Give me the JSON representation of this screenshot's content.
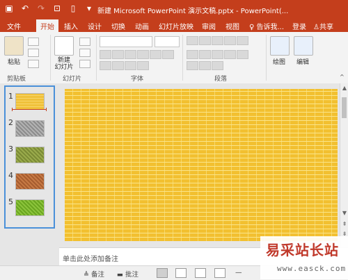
{
  "titlebar": {
    "title": "新建 Microsoft PowerPoint 演示文稿.pptx - PowerPoint(...",
    "bg_color": "#c43e1c"
  },
  "qat": {
    "save_icon": "floppy-icon",
    "undo_icon": "undo-icon",
    "redo_icon": "redo-icon",
    "present_icon": "presentation-icon",
    "new_icon": "new-document-icon"
  },
  "tabs": [
    {
      "label": "文件"
    },
    {
      "label": "开始"
    },
    {
      "label": "插入"
    },
    {
      "label": "设计"
    },
    {
      "label": "切换"
    },
    {
      "label": "动画"
    },
    {
      "label": "幻灯片放映"
    },
    {
      "label": "审阅"
    },
    {
      "label": "视图"
    },
    {
      "label": "♀ 告诉我..."
    },
    {
      "label": "登录"
    },
    {
      "label": "共享"
    }
  ],
  "ribbon": {
    "paste_label": "粘贴",
    "new_slide_label": "新建\n幻灯片",
    "draw_label": "绘图",
    "edit_label": "编辑",
    "groups": {
      "clipboard": "剪贴板",
      "slides": "幻灯片",
      "font": "字体",
      "paragraph": "段落"
    }
  },
  "slides": [
    {
      "number": "1",
      "pattern": "yellow-brick"
    },
    {
      "number": "2",
      "pattern": "gray-brick"
    },
    {
      "number": "3",
      "pattern": "olive-brick"
    },
    {
      "number": "4",
      "pattern": "rust-brick"
    },
    {
      "number": "5",
      "pattern": "green-brick"
    }
  ],
  "notes_placeholder": "单击此处添加备注",
  "status": {
    "notes": "备注",
    "comments": "批注",
    "zoom_minus": "—"
  },
  "watermark": {
    "text": "易采站长站",
    "url": "www.easck.com"
  }
}
